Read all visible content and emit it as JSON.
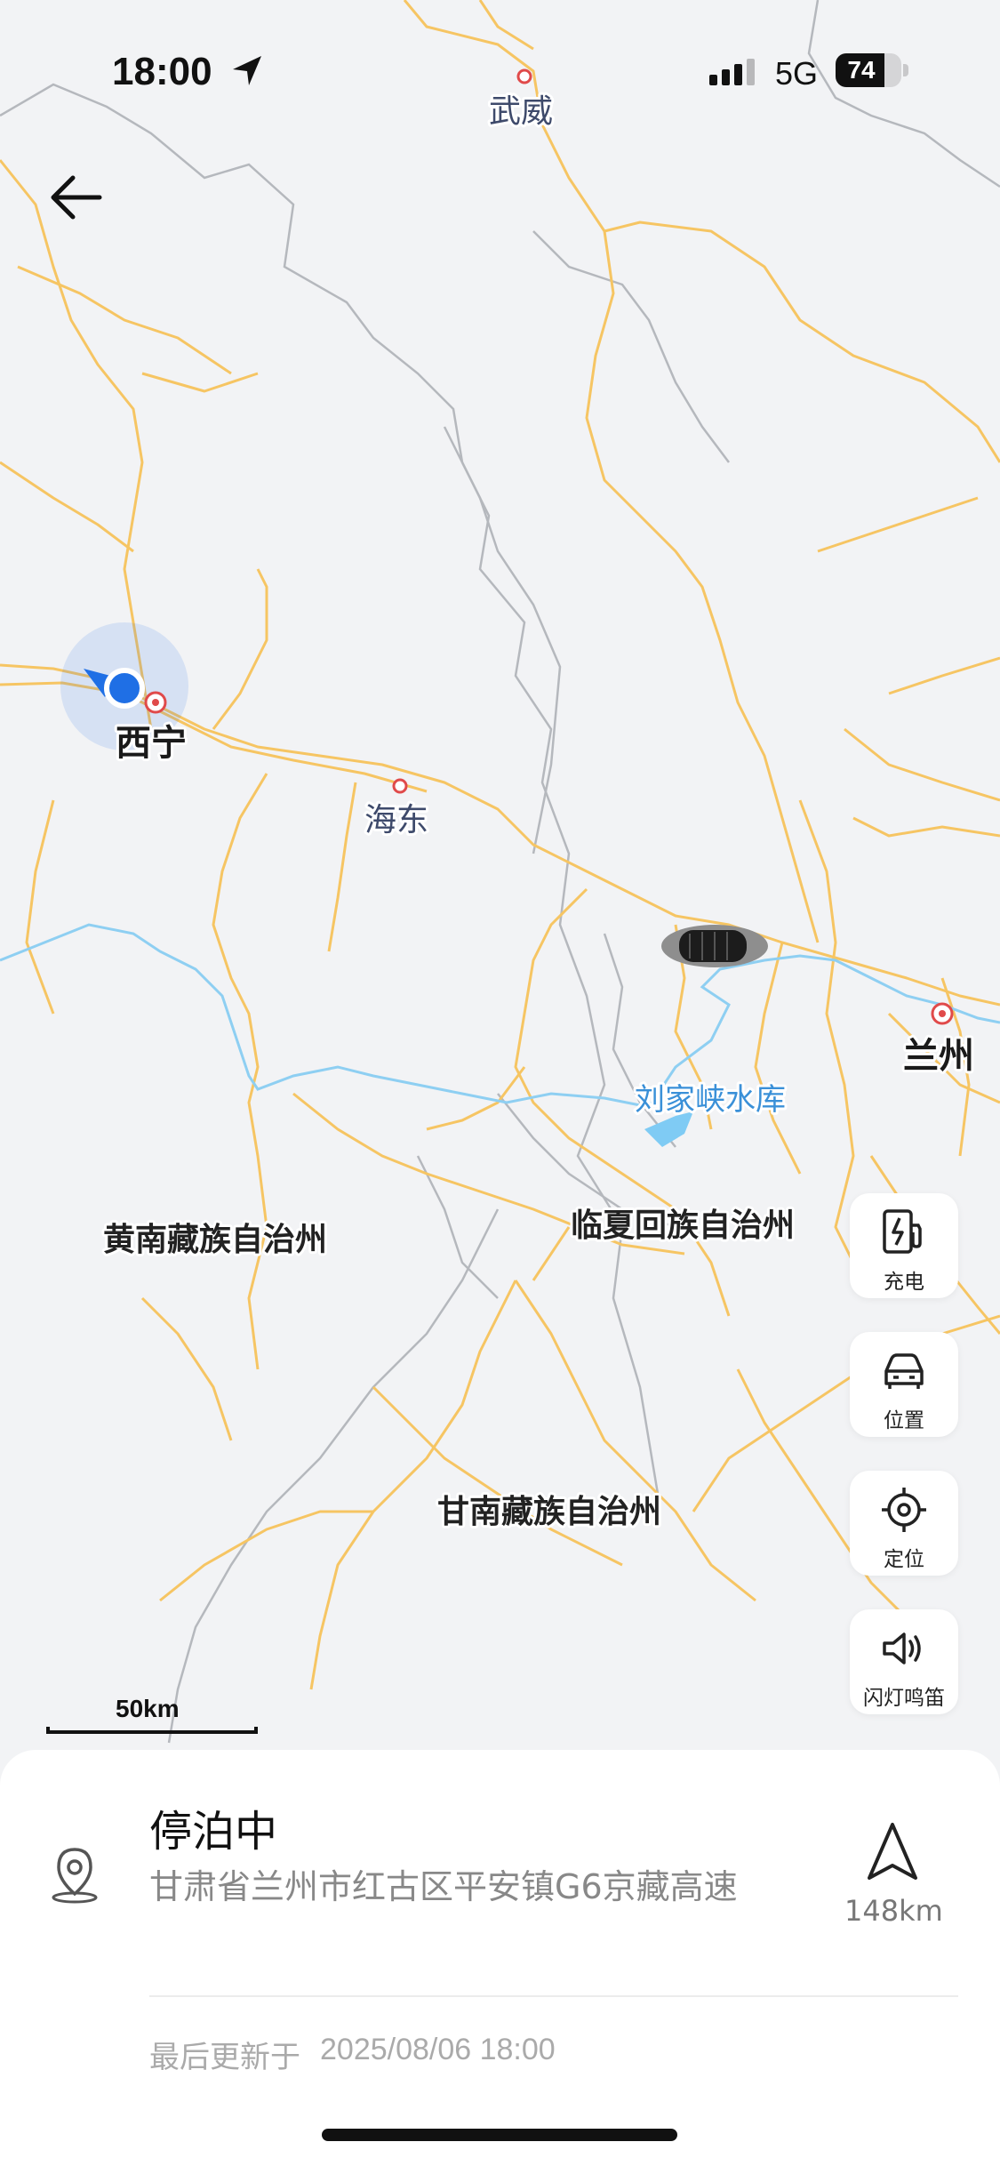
{
  "status_bar": {
    "time": "18:00",
    "network": "5G",
    "battery": "74",
    "battery_level": 0.74
  },
  "map": {
    "cities": {
      "wuwei": "武威",
      "xining": "西宁",
      "haidong": "海东",
      "lanzhou": "兰州"
    },
    "regions": {
      "huangnan": "黄南藏族自治州",
      "linxia": "临夏回族自治州",
      "gannan": "甘南藏族自治州"
    },
    "water": {
      "liujiaxia": "刘家峡水库"
    },
    "scale_label": "50km"
  },
  "side_buttons": {
    "charge": "充电",
    "position": "位置",
    "locate": "定位",
    "horn": "闪灯鸣笛"
  },
  "panel": {
    "status": "停泊中",
    "address": "甘肃省兰州市红古区平安镇G6京藏高速",
    "distance": "148km",
    "updated_label": "最后更新于",
    "updated_time": "2025/08/06 18:00"
  },
  "colors": {
    "road": "#f6c563",
    "boundary": "#b3b6bb",
    "river": "#8ecff2",
    "user_dot": "#1f6fe5",
    "poi": "#e04a4a"
  }
}
